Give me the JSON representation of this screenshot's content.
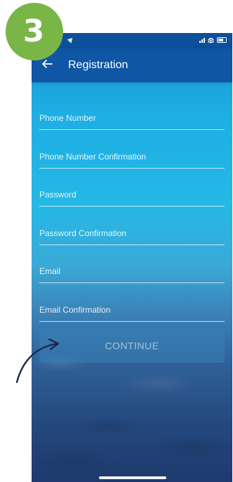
{
  "step_badge": {
    "number": "3",
    "color": "#7ab547"
  },
  "status_bar": {
    "icons": [
      "location-arrow-icon",
      "signal-icon",
      "wifi-icon",
      "battery-icon"
    ]
  },
  "app_bar": {
    "title": "Registration",
    "back_icon": "arrow-left-icon"
  },
  "form": {
    "fields": [
      {
        "placeholder": "Phone Number",
        "value": ""
      },
      {
        "placeholder": "Phone Number Confirmation",
        "value": ""
      },
      {
        "placeholder": "Password",
        "value": ""
      },
      {
        "placeholder": "Password Confirmation",
        "value": ""
      },
      {
        "placeholder": "Email",
        "value": ""
      },
      {
        "placeholder": "Email Confirmation",
        "value": ""
      }
    ],
    "continue_label": "CONTINUE"
  },
  "colors": {
    "app_bar": "#0f56a5",
    "status_bar": "#0d4f9a",
    "badge": "#7ab547",
    "annotation_arrow": "#1a2b4a"
  }
}
